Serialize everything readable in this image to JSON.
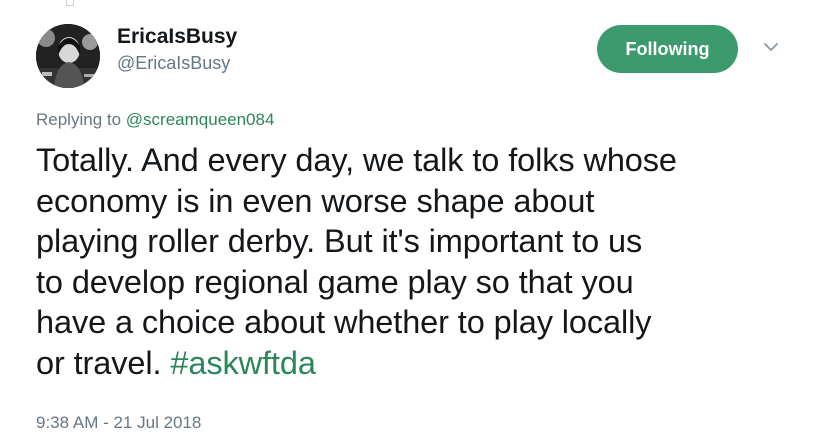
{
  "author": {
    "display_name": "EricaIsBusy",
    "handle": "@EricaIsBusy",
    "avatar": "user-avatar"
  },
  "follow_button": {
    "label": "Following",
    "color": "#3c9a6e"
  },
  "menu_icon": "chevron-down-icon",
  "reply": {
    "prefix": "Replying to",
    "mention": "@screamqueen084"
  },
  "tweet": {
    "lines": [
      "Totally. And every day, we talk to folks whose",
      "economy is in even worse shape about",
      "playing roller derby. But it's important to us",
      "to develop regional game play so that you",
      "have a choice about whether to play locally",
      "or travel."
    ],
    "hashtag": "#askwftda"
  },
  "timestamp": "9:38 AM - 21 Jul 2018",
  "colors": {
    "accent": "#2d8659",
    "secondary_text": "#657786",
    "primary_text": "#14171a"
  }
}
